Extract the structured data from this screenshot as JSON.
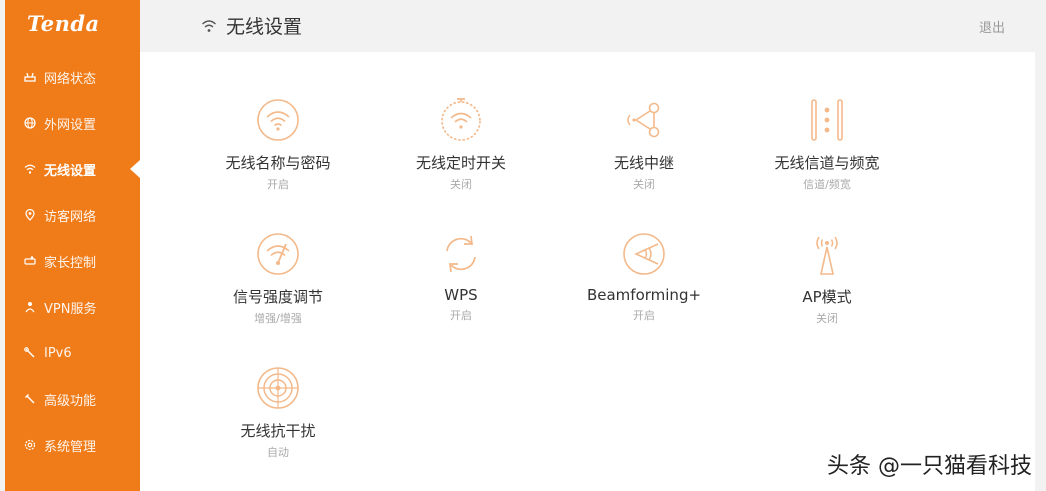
{
  "brand": {
    "logo_text": "Tenda",
    "accent_color": "#f07c19"
  },
  "sidebar": {
    "items": [
      {
        "label": "网络状态",
        "icon": "router-icon"
      },
      {
        "label": "外网设置",
        "icon": "globe-icon"
      },
      {
        "label": "无线设置",
        "icon": "wifi-icon",
        "active": true
      },
      {
        "label": "访客网络",
        "icon": "location-pin-icon"
      },
      {
        "label": "家长控制",
        "icon": "parental-icon"
      },
      {
        "label": "VPN服务",
        "icon": "vpn-icon"
      },
      {
        "label": "IPv6",
        "icon": "wrench-icon"
      },
      {
        "label": "高级功能",
        "icon": "tools-icon"
      },
      {
        "label": "系统管理",
        "icon": "gear-icon"
      }
    ]
  },
  "header": {
    "title": "无线设置",
    "logout": "退出"
  },
  "tiles": [
    {
      "label": "无线名称与密码",
      "status": "开启",
      "icon": "wifi-circle-icon"
    },
    {
      "label": "无线定时开关",
      "status": "关闭",
      "icon": "wifi-timer-icon"
    },
    {
      "label": "无线中继",
      "status": "关闭",
      "icon": "relay-icon"
    },
    {
      "label": "无线信道与频宽",
      "status": "信道/频宽",
      "icon": "channel-icon"
    },
    {
      "label": "信号强度调节",
      "status": "增强/增强",
      "icon": "signal-strength-icon"
    },
    {
      "label": "WPS",
      "status": "开启",
      "icon": "wps-icon"
    },
    {
      "label": "Beamforming+",
      "status": "开启",
      "icon": "beamforming-icon"
    },
    {
      "label": "AP模式",
      "status": "关闭",
      "icon": "ap-tower-icon"
    },
    {
      "label": "无线抗干扰",
      "status": "自动",
      "icon": "anti-interference-icon"
    }
  ],
  "watermark": "头条 @一只猫看科技"
}
